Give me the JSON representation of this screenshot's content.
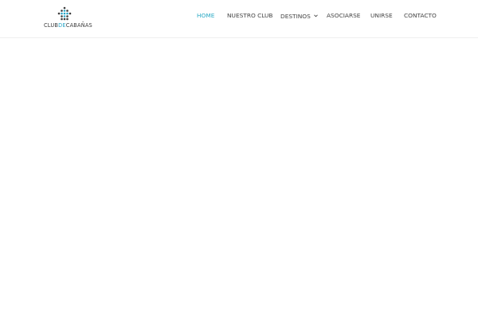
{
  "brand": {
    "name_prefix": "CLUB",
    "name_mid": "DE",
    "name_suffix": "CABAÑAS",
    "accent_color": "#29a6c7",
    "dark_color": "#3b3b3b"
  },
  "nav": {
    "items": [
      {
        "label": "HOME",
        "active": true
      },
      {
        "label": "NUESTRO CLUB",
        "active": false
      },
      {
        "label": "DESTINOS",
        "active": false,
        "has_dropdown": true
      },
      {
        "label": "ASOCIARSE",
        "active": false
      },
      {
        "label": "UNIRSE",
        "active": false
      },
      {
        "label": "CONTACTO",
        "active": false
      }
    ],
    "active_color": "#2aa9c5",
    "text_color": "#444444"
  }
}
